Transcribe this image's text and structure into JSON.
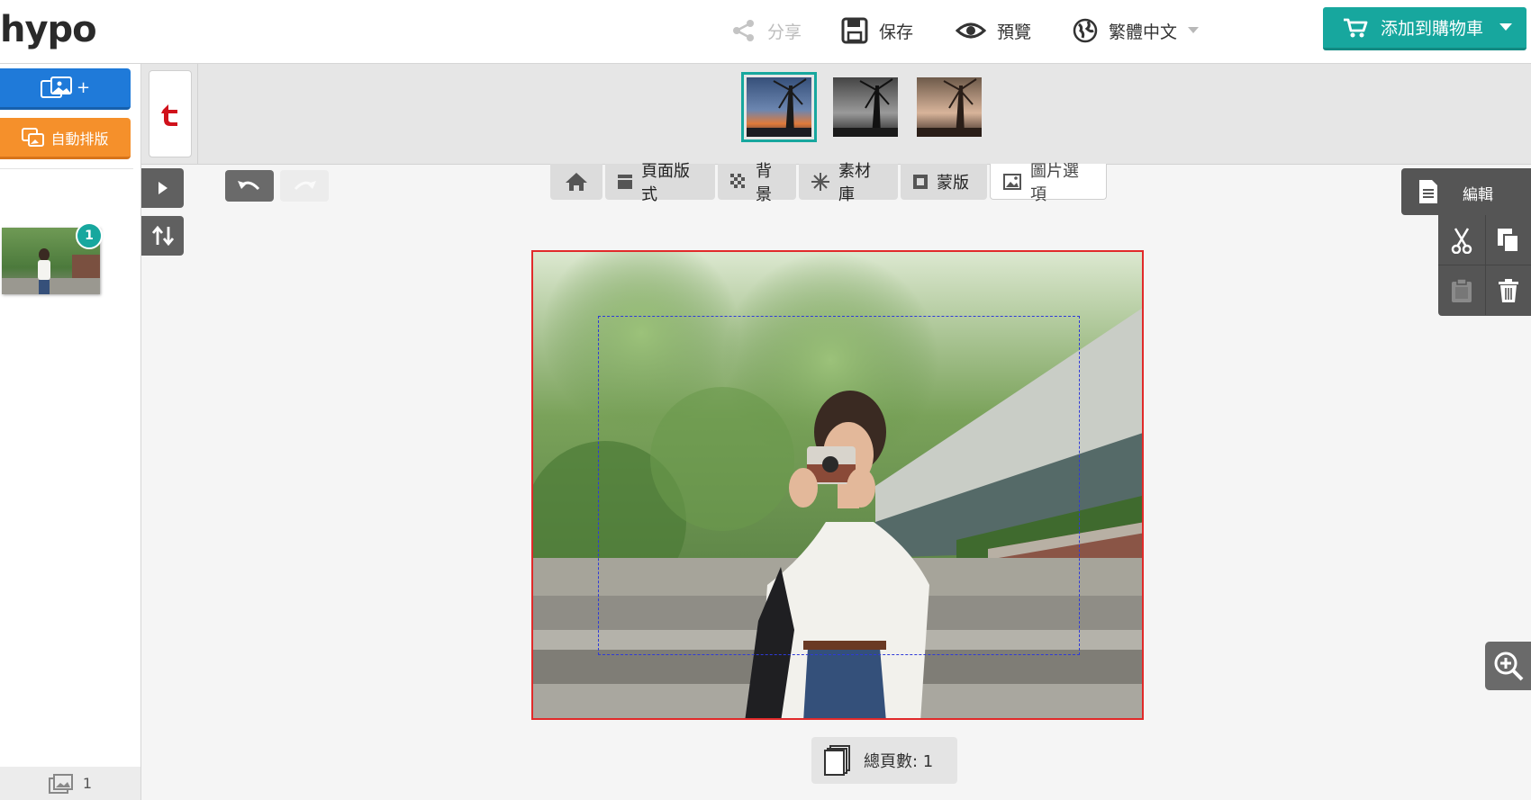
{
  "header": {
    "logo_text": "hypo",
    "share_label": "分享",
    "save_label": "保存",
    "preview_label": "預覽",
    "language_label": "繁體中文",
    "cart_label": "添加到購物車"
  },
  "sidebar": {
    "add_photo_label": "+",
    "auto_layout_label": "自動排版",
    "page_badge": "1",
    "photo_count": "1"
  },
  "tabs": {
    "layout": "頁面版式",
    "background": "背景",
    "materials": "素材庫",
    "mask": "蒙版",
    "image_options": "圖片選項"
  },
  "edit_panel": {
    "edit_label": "編輯"
  },
  "footer": {
    "page_count_label": "總頁數: 1"
  },
  "colors": {
    "accent": "#17a79e",
    "primary_button": "#1f7ad9",
    "auto_button": "#f5902b",
    "canvas_border": "#e12a2a",
    "safe_area": "#2f3ad8",
    "brand_red": "#d0111b"
  },
  "icons": {
    "share": "share-icon",
    "save": "floppy-disk-icon",
    "preview": "eye-icon",
    "language": "globe-icon",
    "cart": "cart-icon",
    "home": "home-icon",
    "undo": "undo-icon",
    "redo": "redo-icon",
    "cut": "scissors-icon",
    "copy": "copy-icon",
    "paste": "clipboard-icon",
    "delete": "trash-icon",
    "zoom": "zoom-in-icon"
  }
}
